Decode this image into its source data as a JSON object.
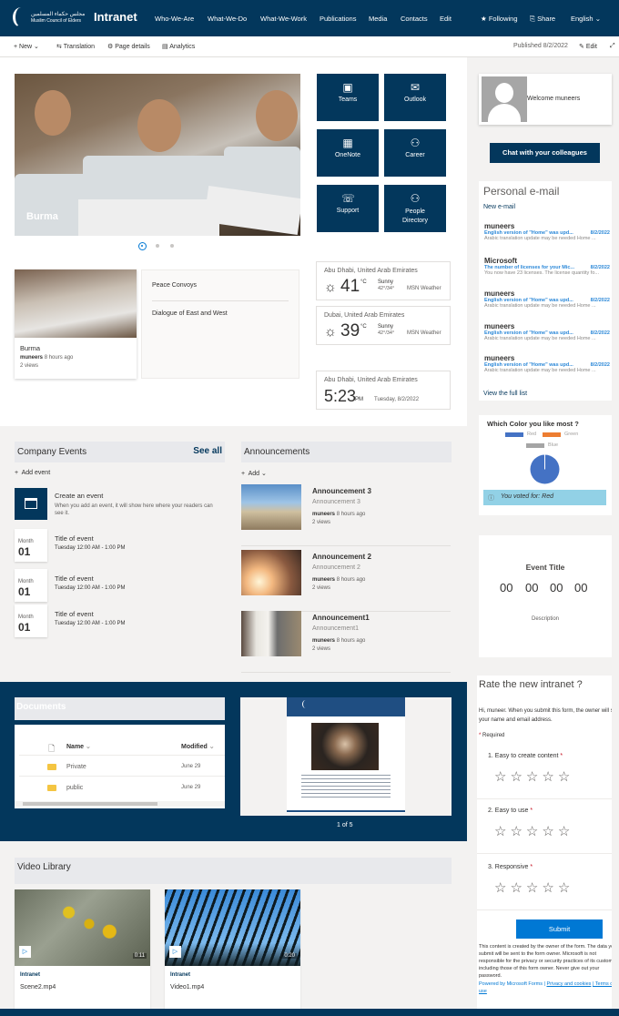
{
  "topnav": {
    "logo_arabic": "مجلس حكماء المسلمين",
    "logo_english": "Muslim Council of Elders",
    "site_title": "Intranet",
    "items": [
      "Who-We-Are",
      "What-We-Do",
      "What-We-Work",
      "Publications",
      "Media",
      "Contacts",
      "Edit"
    ],
    "following": "Following",
    "share": "Share",
    "language": "English"
  },
  "commandbar": {
    "new": "New",
    "translation": "Translation",
    "page_details": "Page details",
    "analytics": "Analytics",
    "published": "Published 8/2/2022",
    "edit": "Edit"
  },
  "hero": {
    "caption": "Burma",
    "slides": 3,
    "active_slide": 1
  },
  "quick_links": [
    "Teams",
    "Outlook",
    "OneNote",
    "Career",
    "Support",
    "People Directory"
  ],
  "news": {
    "card": {
      "title": "Burma",
      "author": "muneers",
      "time": "8 hours ago",
      "views": "2 views"
    },
    "links": [
      "Peace Convoys",
      "Dialogue of East and West"
    ]
  },
  "weather": [
    {
      "location": "Abu Dhabi, United Arab Emirates",
      "temp": "41",
      "unit": "°C",
      "condition": "Sunny",
      "range": "42°/34°",
      "source": "MSN Weather"
    },
    {
      "location": "Dubai, United Arab Emirates",
      "temp": "39",
      "unit": "°C",
      "condition": "Sunny",
      "range": "42°/34°",
      "source": "MSN Weather"
    }
  ],
  "clock": {
    "location": "Abu Dhabi, United Arab Emirates",
    "time": "5:23",
    "ampm": "PM",
    "date": "Tuesday, 8/2/2022"
  },
  "events": {
    "title": "Company Events",
    "see_all": "See all",
    "add": "Add event",
    "create_title": "Create an event",
    "create_desc": "When you add an event, it will show here where your readers can see it.",
    "items": [
      {
        "month": "Month",
        "day": "01",
        "title": "Title of event",
        "time": "Tuesday 12:00 AM - 1:00 PM"
      },
      {
        "month": "Month",
        "day": "01",
        "title": "Title of event",
        "time": "Tuesday 12:00 AM - 1:00 PM"
      },
      {
        "month": "Month",
        "day": "01",
        "title": "Title of event",
        "time": "Tuesday 12:00 AM - 1:00 PM"
      }
    ]
  },
  "announcements": {
    "title": "Announcements",
    "add": "Add",
    "items": [
      {
        "title": "Announcement 3",
        "sub": "Announcement 3",
        "author": "muneers",
        "time": "8 hours ago",
        "views": "2 views"
      },
      {
        "title": "Announcement 2",
        "sub": "Announcement 2",
        "author": "muneers",
        "time": "8 hours ago",
        "views": "2 views"
      },
      {
        "title": "Announcement1",
        "sub": "Announcement1",
        "author": "muneers",
        "time": "8 hours ago",
        "views": "2 views"
      }
    ]
  },
  "documents": {
    "title": "Documents",
    "col_name": "Name",
    "col_modified": "Modified",
    "rows": [
      {
        "name": "Private",
        "modified": "June 29"
      },
      {
        "name": "public",
        "modified": "June 29"
      }
    ]
  },
  "viewer": {
    "page": "1 of 5"
  },
  "video_library": {
    "title": "Video Library",
    "items": [
      {
        "site": "Intranet",
        "name": "Scene2.mp4",
        "duration": "0:11"
      },
      {
        "site": "Intranet",
        "name": "Video1.mp4",
        "duration": "0:20"
      }
    ]
  },
  "profile": {
    "welcome": "Welcome muneers",
    "chat_button": "Chat with your colleagues"
  },
  "mail": {
    "title": "Personal e-mail",
    "new": "New e-mail",
    "items": [
      {
        "from": "muneers",
        "subject": "English version of \"Home\" was upd...",
        "date": "8/2/2022",
        "preview": "Arabic translation update may be needed Home ..."
      },
      {
        "from": "Microsoft",
        "subject": "The number of licenses for your Mic...",
        "date": "8/2/2022",
        "preview": "You now have 23 licenses. The license quantity fo..."
      },
      {
        "from": "muneers",
        "subject": "English version of \"Home\" was upd...",
        "date": "8/2/2022",
        "preview": "Arabic translation update may be needed Home ..."
      },
      {
        "from": "muneers",
        "subject": "English version of \"Home\" was upd...",
        "date": "8/2/2022",
        "preview": "Arabic translation update may be needed Home ..."
      },
      {
        "from": "muneers",
        "subject": "English version of \"Home\" was upd...",
        "date": "8/2/2022",
        "preview": "Arabic translation update may be needed Home ..."
      }
    ],
    "view_all": "View the full list"
  },
  "poll": {
    "question": "Which Color you like most ?",
    "legend": [
      {
        "label": "Red",
        "color": "#4472c4"
      },
      {
        "label": "Green",
        "color": "#ed7d31"
      },
      {
        "label": "Blue",
        "color": "#a5a5a5"
      }
    ],
    "voted": "You voted for: Red"
  },
  "chart_data": {
    "type": "pie",
    "title": "Which Color you like most ?",
    "categories": [
      "Red",
      "Green",
      "Blue"
    ],
    "values": [
      100,
      0,
      0
    ],
    "legend_position": "top"
  },
  "countdown": {
    "title": "Event Title",
    "values": [
      "00",
      "00",
      "00",
      "00"
    ],
    "description": "Description"
  },
  "form": {
    "title": "Rate the new intranet ?",
    "intro": "Hi, muneer. When you submit this form, the owner will see your name and email address.",
    "required": "Required",
    "questions": [
      "1. Easy to create content",
      "2. Easy to use",
      "3. Responsive"
    ],
    "rating_max": 5,
    "submit": "Submit",
    "disclaimer": "This content is created by the owner of the form. The data you submit will be sent to the form owner. Microsoft is not responsible for the privacy or security practices of its customers, including those of this form owner. Never give out your password.",
    "powered": "Powered by Microsoft Forms |",
    "privacy": "Privacy and cookies",
    "terms": "| Terms of use"
  },
  "colors": {
    "brand": "#03375c",
    "accent": "#0078d4"
  }
}
